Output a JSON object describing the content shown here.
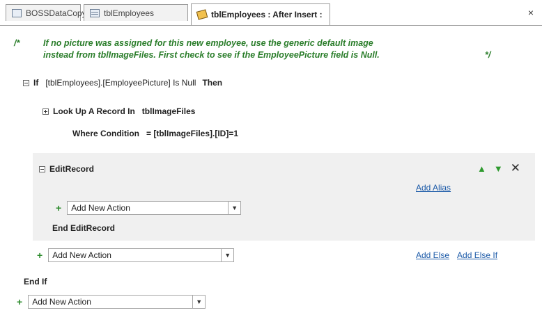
{
  "tabs": [
    {
      "label": "BOSSDataCopy",
      "icon": "database-icon"
    },
    {
      "label": "tblEmployees",
      "icon": "table-icon"
    },
    {
      "label": "tblEmployees : After Insert :",
      "icon": "macro-icon",
      "active": true
    }
  ],
  "tab_close": "×",
  "comment": {
    "open": "/*",
    "line1": "If no picture was assigned for this new employee, use the generic default image",
    "line2": "instead from tblImageFiles. First check to see if the EmployeePicture field is Null.",
    "close": "*/"
  },
  "if_block": {
    "keyword": "If",
    "condition": "[tblEmployees].[EmployeePicture] Is Null",
    "then": "Then"
  },
  "lookup": {
    "label": "Look Up A Record In",
    "table": "tblImageFiles",
    "where_label": "Where Condition",
    "where_value": "= [tblImageFiles].[ID]=1"
  },
  "edit_record": {
    "label": "EditRecord",
    "add_alias": "Add Alias",
    "action_placeholder": "Add New Action",
    "end_label": "End EditRecord"
  },
  "outer_action": "Add New Action",
  "add_else": "Add Else",
  "add_else_if": "Add Else If",
  "end_if": "End If",
  "bottom_action": "Add New Action"
}
